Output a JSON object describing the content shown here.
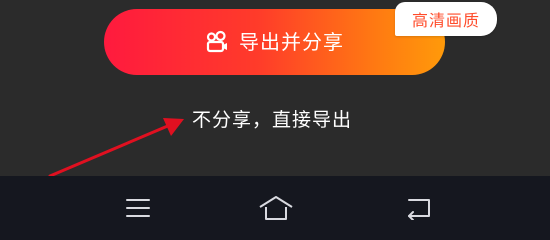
{
  "export": {
    "label": "导出并分享",
    "icon": "video-camera-icon",
    "gradient_start": "#ff1a3e",
    "gradient_end": "#ff9a0a"
  },
  "quality_badge": {
    "label": "高清画质",
    "color": "#ff4b2a"
  },
  "no_share": {
    "label": "不分享，直接导出"
  },
  "annotation": {
    "arrow_color": "#e01020"
  },
  "navbar": {
    "items": [
      {
        "icon": "menu-icon"
      },
      {
        "icon": "home-icon"
      },
      {
        "icon": "back-icon"
      }
    ]
  }
}
